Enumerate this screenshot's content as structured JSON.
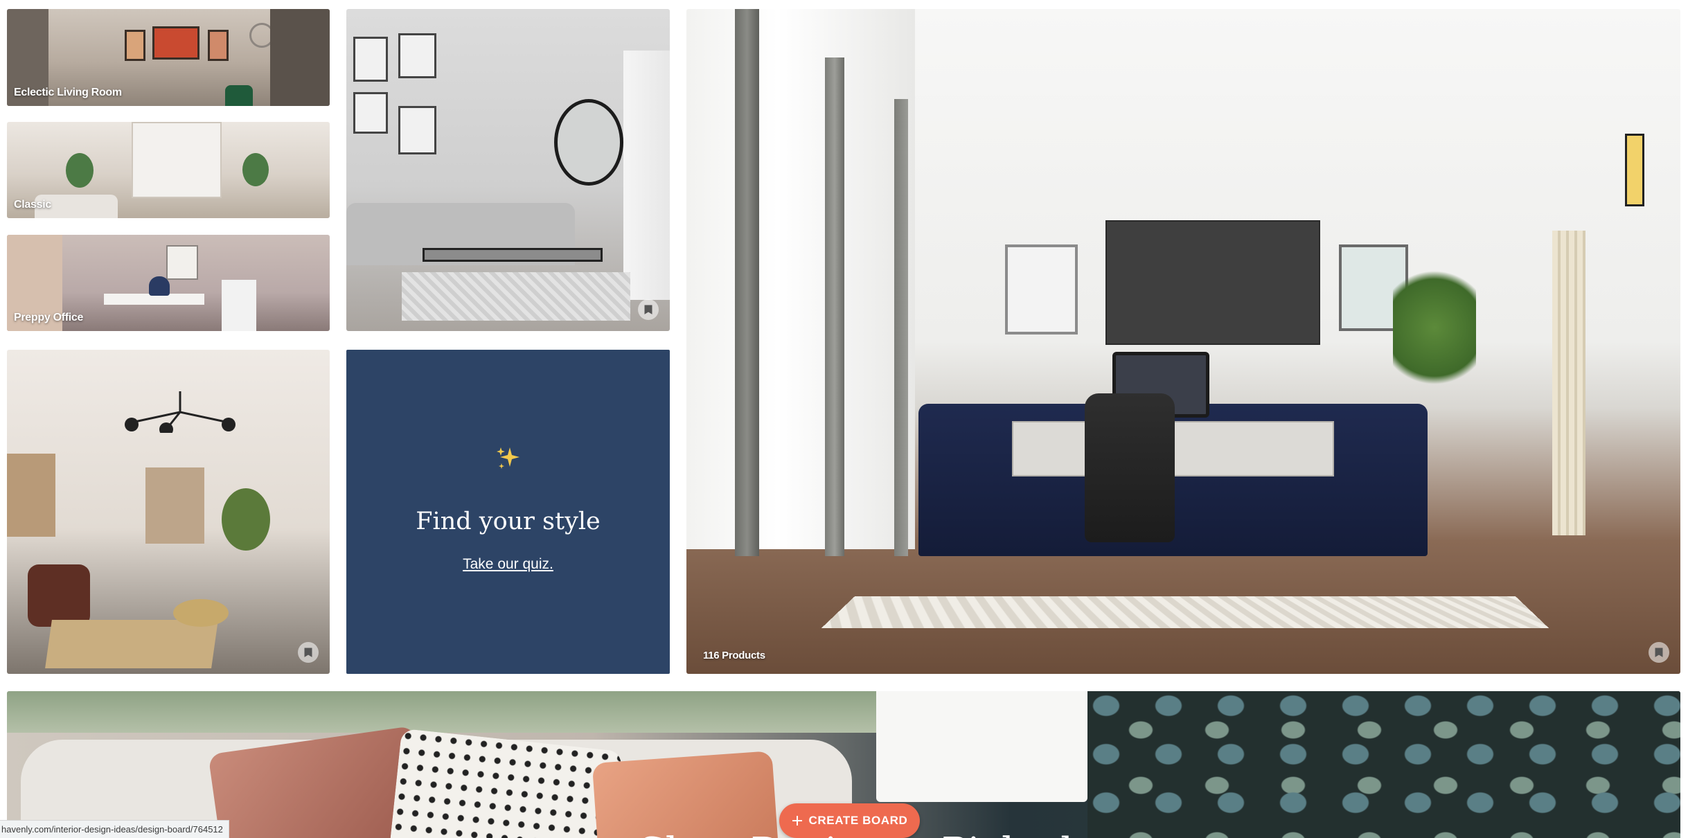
{
  "tiles": {
    "eclectic_living_room": {
      "label": "Eclectic Living Room"
    },
    "classic": {
      "label": "Classic"
    },
    "preppy_office": {
      "label": "Preppy Office"
    }
  },
  "quiz": {
    "title": "Find your style",
    "link": "Take our quiz.",
    "icon": "sparkles-icon",
    "background_color": "#2d4466",
    "icon_color": "#f2c94c"
  },
  "featured": {
    "products_count": "116 Products"
  },
  "banner": {
    "heading": "Shop Designer-Picked",
    "create_board_label": "CREATE BOARD",
    "create_board_icon": "plus-icon",
    "create_board_color": "#ee6a4f"
  },
  "status_bar": {
    "url": "havenly.com/interior-design-ideas/design-board/764512"
  }
}
